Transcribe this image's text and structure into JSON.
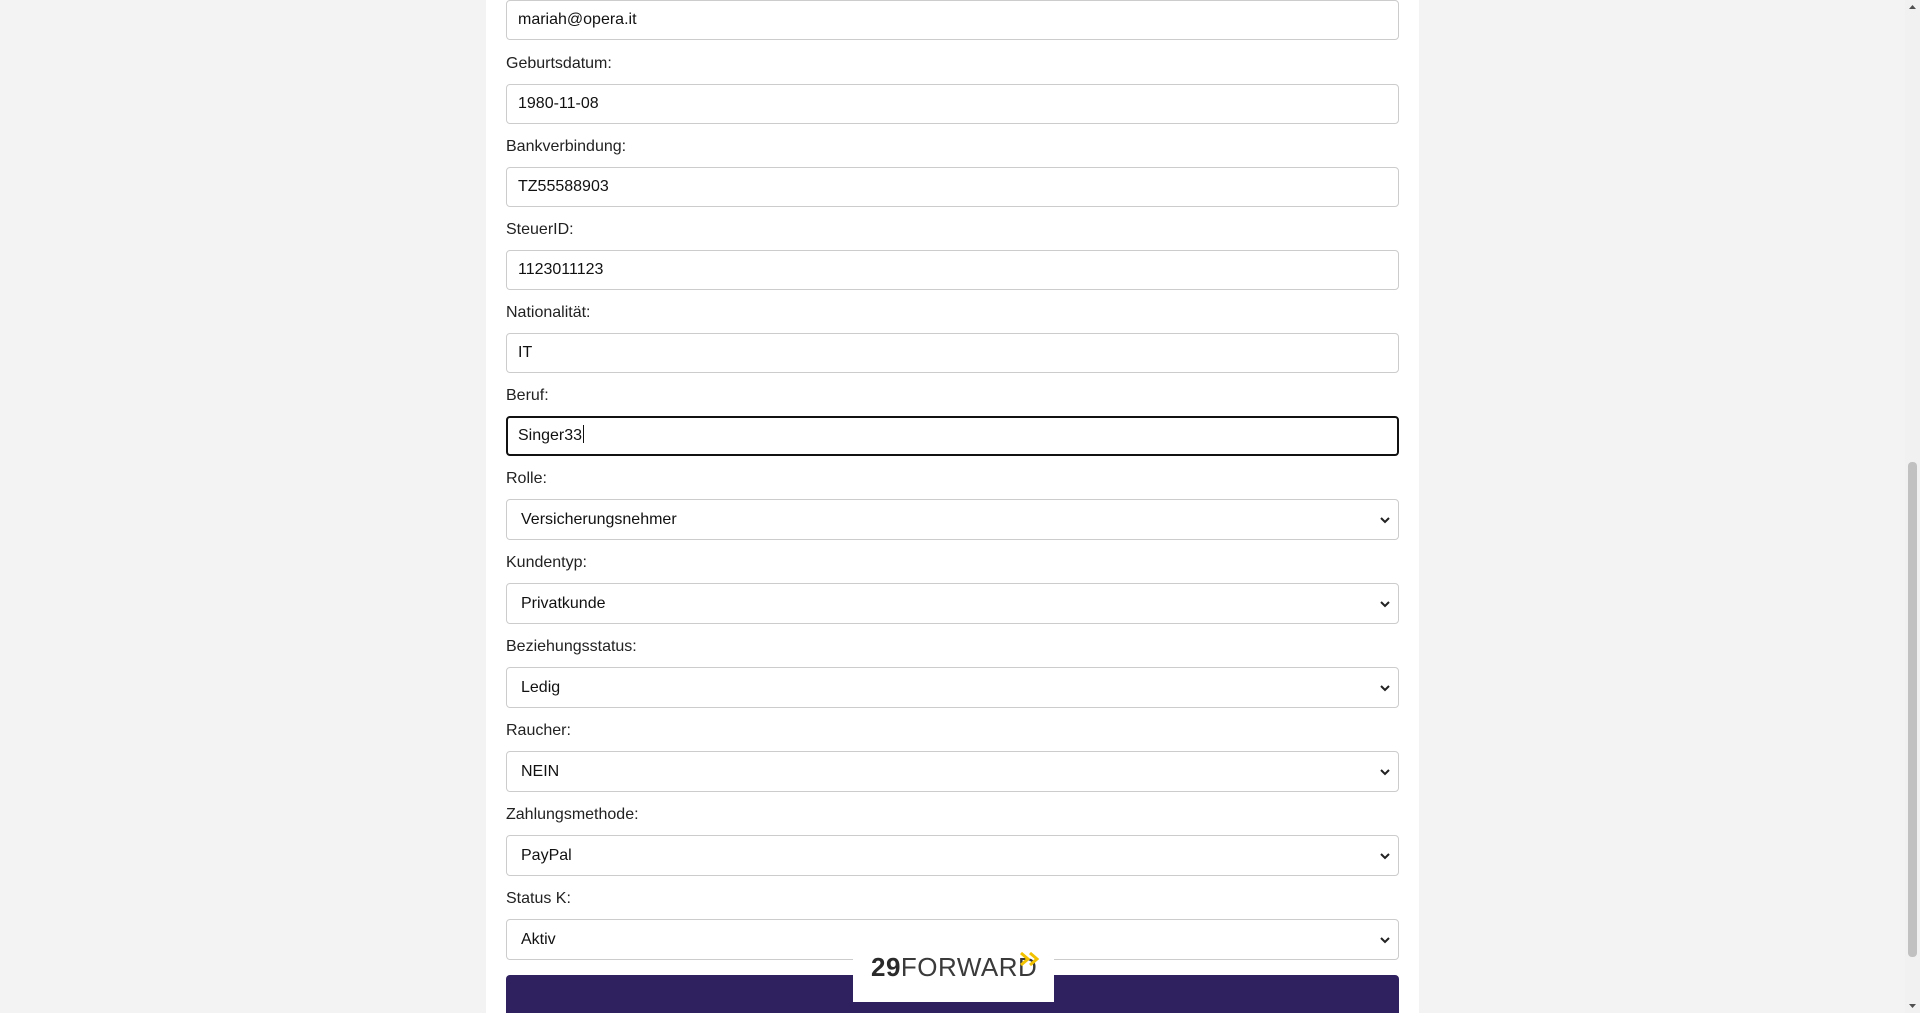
{
  "form": {
    "email": {
      "value": "mariah@opera.it"
    },
    "birthdate": {
      "label": "Geburtsdatum:",
      "value": "1980-11-08"
    },
    "bank": {
      "label": "Bankverbindung:",
      "value": "TZ55588903"
    },
    "tax_id": {
      "label": "SteuerID:",
      "value": "1123011123"
    },
    "nationality": {
      "label": "Nationalität:",
      "value": "IT"
    },
    "occupation": {
      "label": "Beruf:",
      "value": "Singer33"
    },
    "role": {
      "label": "Rolle:",
      "selected": "Versicherungsnehmer"
    },
    "customer_type": {
      "label": "Kundentyp:",
      "selected": "Privatkunde"
    },
    "relationship": {
      "label": "Beziehungsstatus:",
      "selected": "Ledig"
    },
    "smoker": {
      "label": "Raucher:",
      "selected": "NEIN"
    },
    "payment": {
      "label": "Zahlungsmethode:",
      "selected": "PayPal"
    },
    "status": {
      "label": "Status K:",
      "selected": "Aktiv"
    }
  },
  "logo": {
    "number": "29",
    "word": "FORWARD",
    "accent_color": "#f2c200"
  },
  "colors": {
    "submit": "#2f2060",
    "background": "#f3f3f3"
  }
}
